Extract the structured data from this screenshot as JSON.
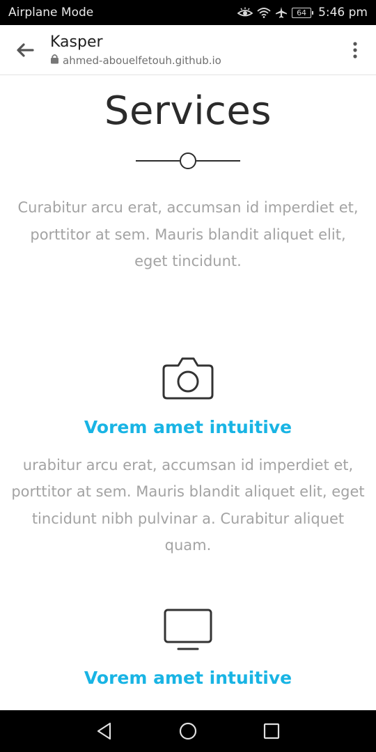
{
  "status_bar": {
    "left_text": "Airplane Mode",
    "battery_level": "64",
    "time": "5:46 pm",
    "icons": [
      "eye-comfort-icon",
      "wifi-icon",
      "airplane-icon",
      "battery-icon"
    ]
  },
  "browser": {
    "title": "Kasper",
    "url": "ahmed-abouelfetouh.github.io",
    "icons": [
      "back-arrow-icon",
      "lock-icon",
      "more-vertical-icon"
    ]
  },
  "section": {
    "title": "Services",
    "intro": "Curabitur arcu erat, accumsan id imperdiet et, porttitor at sem. Mauris blandit aliquet elit, eget tincidunt."
  },
  "services": [
    {
      "icon": "camera-icon",
      "heading": "Vorem amet intuitive",
      "text": "urabitur arcu erat, accumsan id imperdiet et, porttitor at sem. Mauris blandit aliquet elit, eget tincidunt nibh pulvinar a. Curabitur aliquet quam."
    },
    {
      "icon": "monitor-icon",
      "heading": "Vorem amet intuitive",
      "text": ""
    }
  ],
  "colors": {
    "accent": "#19b4e4",
    "body_text": "#a3a3a3",
    "title_text": "#2b2b2b"
  },
  "nav_bar": {
    "icons": [
      "back-triangle-icon",
      "home-circle-icon",
      "recents-square-icon"
    ]
  }
}
